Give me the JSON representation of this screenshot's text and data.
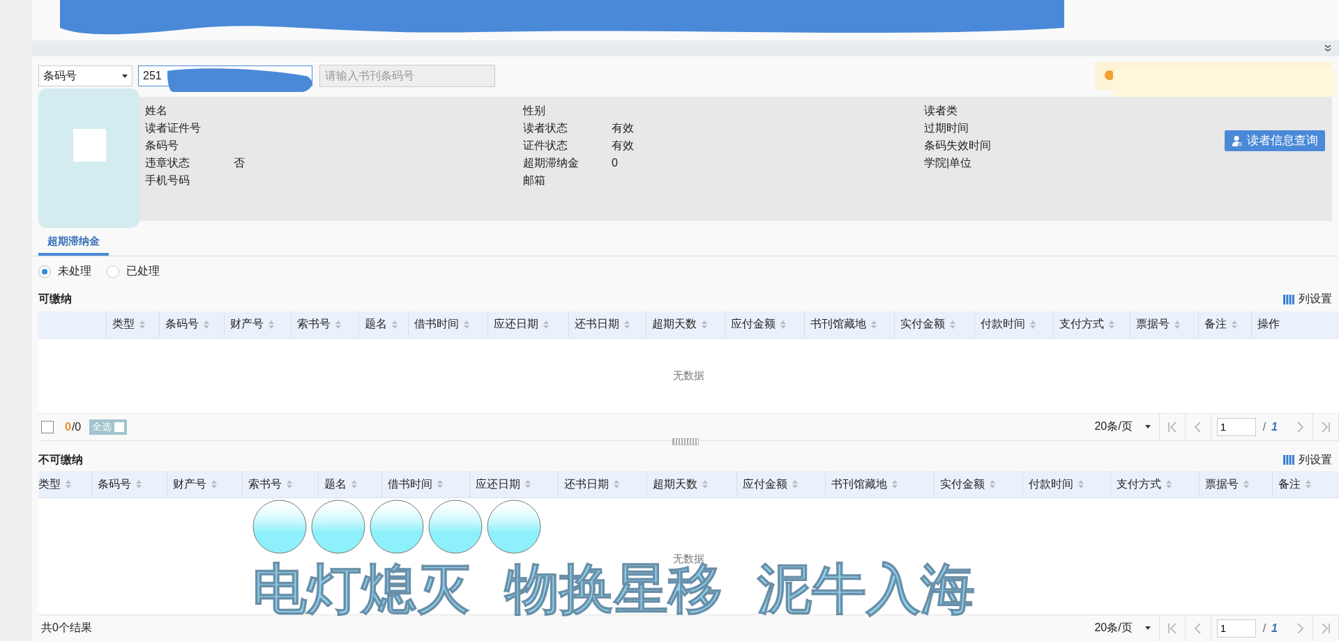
{
  "search": {
    "mode": "条码号",
    "reader_value": "251",
    "book_placeholder": "请输入书刊条码号"
  },
  "reader": {
    "columns": [
      [
        {
          "label": "姓名"
        },
        {
          "label": "读者证件号"
        },
        {
          "label": "条码号"
        },
        {
          "label": "违章状态",
          "value": "否"
        },
        {
          "label": "手机号码"
        }
      ],
      [
        {
          "label": "性别"
        },
        {
          "label": "读者状态",
          "value": "有效"
        },
        {
          "label": "证件状态",
          "value": "有效"
        },
        {
          "label": "超期滞纳金",
          "value": "0"
        },
        {
          "label": "邮箱"
        }
      ],
      [
        {
          "label": "读者类"
        },
        {
          "label": "过期时间"
        },
        {
          "label": "条码失效时间"
        },
        {
          "label": "学院|单位"
        }
      ]
    ],
    "button": "读者信息查询"
  },
  "tabs": [
    {
      "label": "超期滞纳金",
      "selected": true
    }
  ],
  "filters": [
    {
      "label": "未处理",
      "selected": true
    },
    {
      "label": "已处理",
      "selected": false
    }
  ],
  "tables": [
    {
      "title": "可缴纳",
      "settings": "列设置",
      "empty": "无数据",
      "columns": [
        {
          "label": "类型",
          "sortable": true
        },
        {
          "label": "条码号",
          "sortable": true
        },
        {
          "label": "财产号",
          "sortable": true
        },
        {
          "label": "索书号",
          "sortable": true
        },
        {
          "label": "题名",
          "sortable": true
        },
        {
          "label": "借书时间",
          "sortable": true
        },
        {
          "label": "应还日期",
          "sortable": true
        },
        {
          "label": "还书日期",
          "sortable": true
        },
        {
          "label": "超期天数",
          "sortable": true
        },
        {
          "label": "应付金额",
          "sortable": true
        },
        {
          "label": "书刊馆藏地",
          "sortable": true
        },
        {
          "label": "实付金额",
          "sortable": true
        },
        {
          "label": "付款时间",
          "sortable": true
        },
        {
          "label": "支付方式",
          "sortable": true
        },
        {
          "label": "票据号",
          "sortable": true
        },
        {
          "label": "备注",
          "sortable": true
        },
        {
          "label": "操作",
          "sortable": false
        }
      ],
      "footer": {
        "kind": "selection",
        "checked": false,
        "count": "0",
        "total": "/0",
        "select_all": "全选"
      },
      "pagination": {
        "page_size": "20条/页",
        "page": "1",
        "of": "/",
        "pages": "1"
      }
    },
    {
      "title": "不可缴纳",
      "settings": "列设置",
      "empty": "无数据",
      "columns": [
        {
          "label": "类型",
          "sortable": true
        },
        {
          "label": "条码号",
          "sortable": true
        },
        {
          "label": "财产号",
          "sortable": true
        },
        {
          "label": "索书号",
          "sortable": true
        },
        {
          "label": "题名",
          "sortable": true
        },
        {
          "label": "借书时间",
          "sortable": true
        },
        {
          "label": "应还日期",
          "sortable": true
        },
        {
          "label": "还书日期",
          "sortable": true
        },
        {
          "label": "超期天数",
          "sortable": true
        },
        {
          "label": "应付金额",
          "sortable": true
        },
        {
          "label": "书刊馆藏地",
          "sortable": true
        },
        {
          "label": "实付金额",
          "sortable": true
        },
        {
          "label": "付款时间",
          "sortable": true
        },
        {
          "label": "支付方式",
          "sortable": true
        },
        {
          "label": "票据号",
          "sortable": true
        },
        {
          "label": "备注",
          "sortable": true
        }
      ],
      "footer": {
        "kind": "summary",
        "summary": "共0个结果"
      },
      "pagination": {
        "page_size": "20条/页",
        "page": "1",
        "of": "/",
        "pages": "1"
      }
    }
  ],
  "overlay": {
    "phrases": [
      "电灯熄灭",
      "物换星移",
      "泥牛入海"
    ]
  }
}
